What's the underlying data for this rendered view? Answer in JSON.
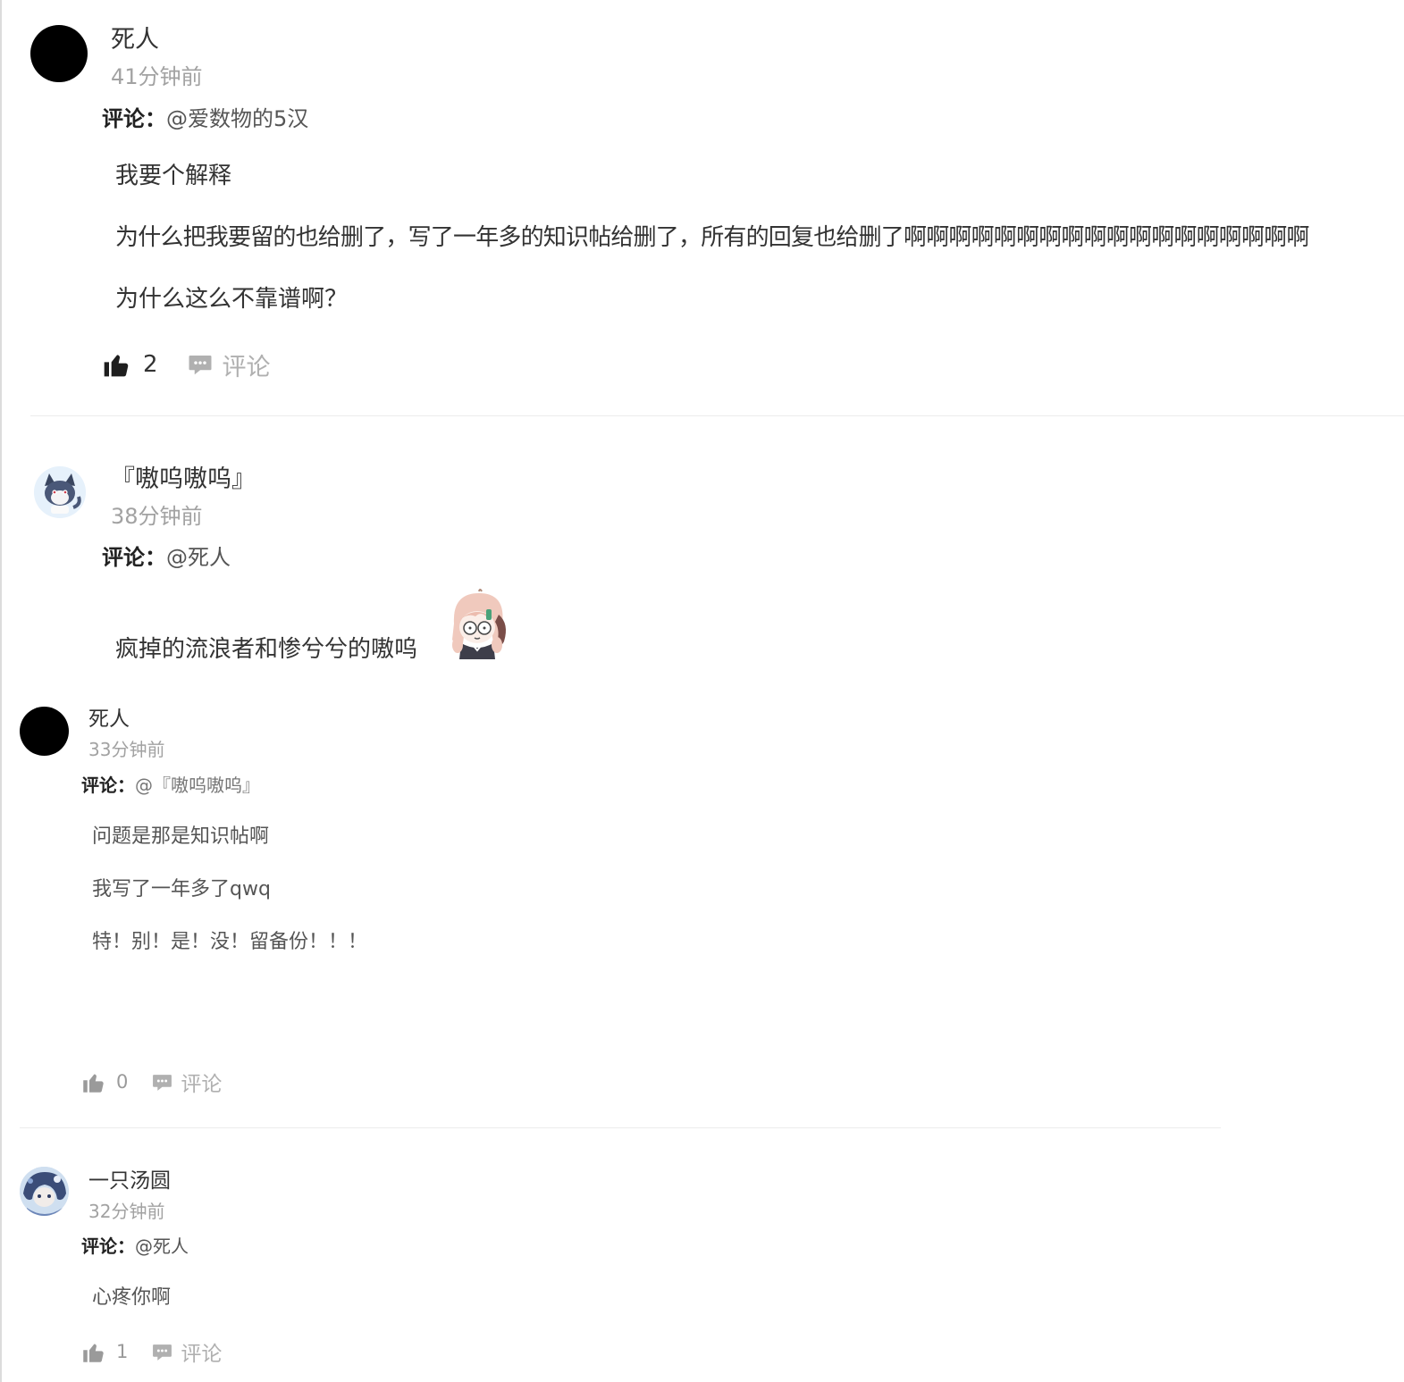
{
  "comments": [
    {
      "username": "死人",
      "time": "41分钟前",
      "reply_label": "评论：",
      "reply_to": "@爱数物的5汉",
      "lines": [
        "我要个解释",
        "为什么把我要留的也给删了，写了一年多的知识帖给删了，所有的回复也给删了啊啊啊啊啊啊啊啊啊啊啊啊啊啊啊啊啊啊",
        "为什么这么不靠谱啊？"
      ],
      "likes": "2",
      "comment_label": "评论",
      "avatar_icon": "black-circle-avatar",
      "like_color": "#1e1e1e"
    },
    {
      "username": "『嗷呜嗷呜』",
      "time": "38分钟前",
      "reply_label": "评论：",
      "reply_to": "@死人",
      "lines": [
        "疯掉的流浪者和惨兮兮的嗷呜"
      ],
      "avatar_icon": "cartoon-wolf-avatar",
      "sticker_icon": "anime-girl-sticker"
    },
    {
      "username": "死人",
      "time": "33分钟前",
      "reply_label": "评论：",
      "reply_to": "@『嗷呜嗷呜』",
      "lines": [
        "问题是那是知识帖啊",
        "我写了一年多了qwq",
        "特！别！是！没！留备份！！！"
      ],
      "likes": "0",
      "comment_label": "评论",
      "avatar_icon": "black-circle-avatar",
      "like_color": "#9a9a9a"
    },
    {
      "username": "一只汤圆",
      "time": "32分钟前",
      "reply_label": "评论：",
      "reply_to": "@死人",
      "lines": [
        "心疼你啊"
      ],
      "likes": "1",
      "comment_label": "评论",
      "avatar_icon": "blue-anime-avatar",
      "like_color": "#9a9a9a"
    }
  ]
}
